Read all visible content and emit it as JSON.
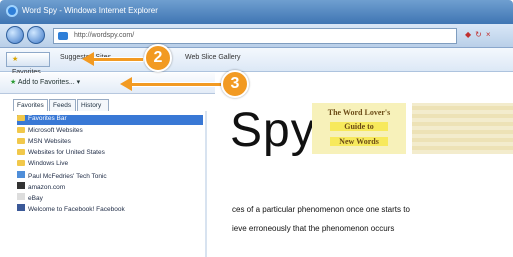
{
  "window": {
    "title": "Word Spy - Windows Internet Explorer",
    "address": "http://wordspy.com/"
  },
  "toolbar": {
    "favorites_label": "Favorites",
    "favorites_bar_label": "Suggested Sites",
    "web_slice_label": "Web Slice Gallery"
  },
  "favorites_panel": {
    "add_button": "Add to Favorites...",
    "tabs": [
      "Favorites",
      "Feeds",
      "History"
    ],
    "items": [
      "Favorites Bar",
      "Microsoft Websites",
      "MSN Websites",
      "Websites for United States",
      "Windows Live",
      "Paul McFedries' Tech Tonic",
      "amazon.com",
      "eBay",
      "Welcome to Facebook! Facebook"
    ]
  },
  "page": {
    "logo_text": "Spy",
    "promo_lines": [
      "The Word Lover's",
      "Guide to",
      "New Words"
    ],
    "text_lines": [
      "ces of a particular phenomenon once one starts to",
      "ieve erroneously that the phenomenon occurs"
    ]
  },
  "callouts": {
    "two": "2",
    "three": "3"
  },
  "colors": {
    "accent": "#f29a22",
    "title_blue": "#3f75b3",
    "selected_blue": "#3978d5"
  }
}
